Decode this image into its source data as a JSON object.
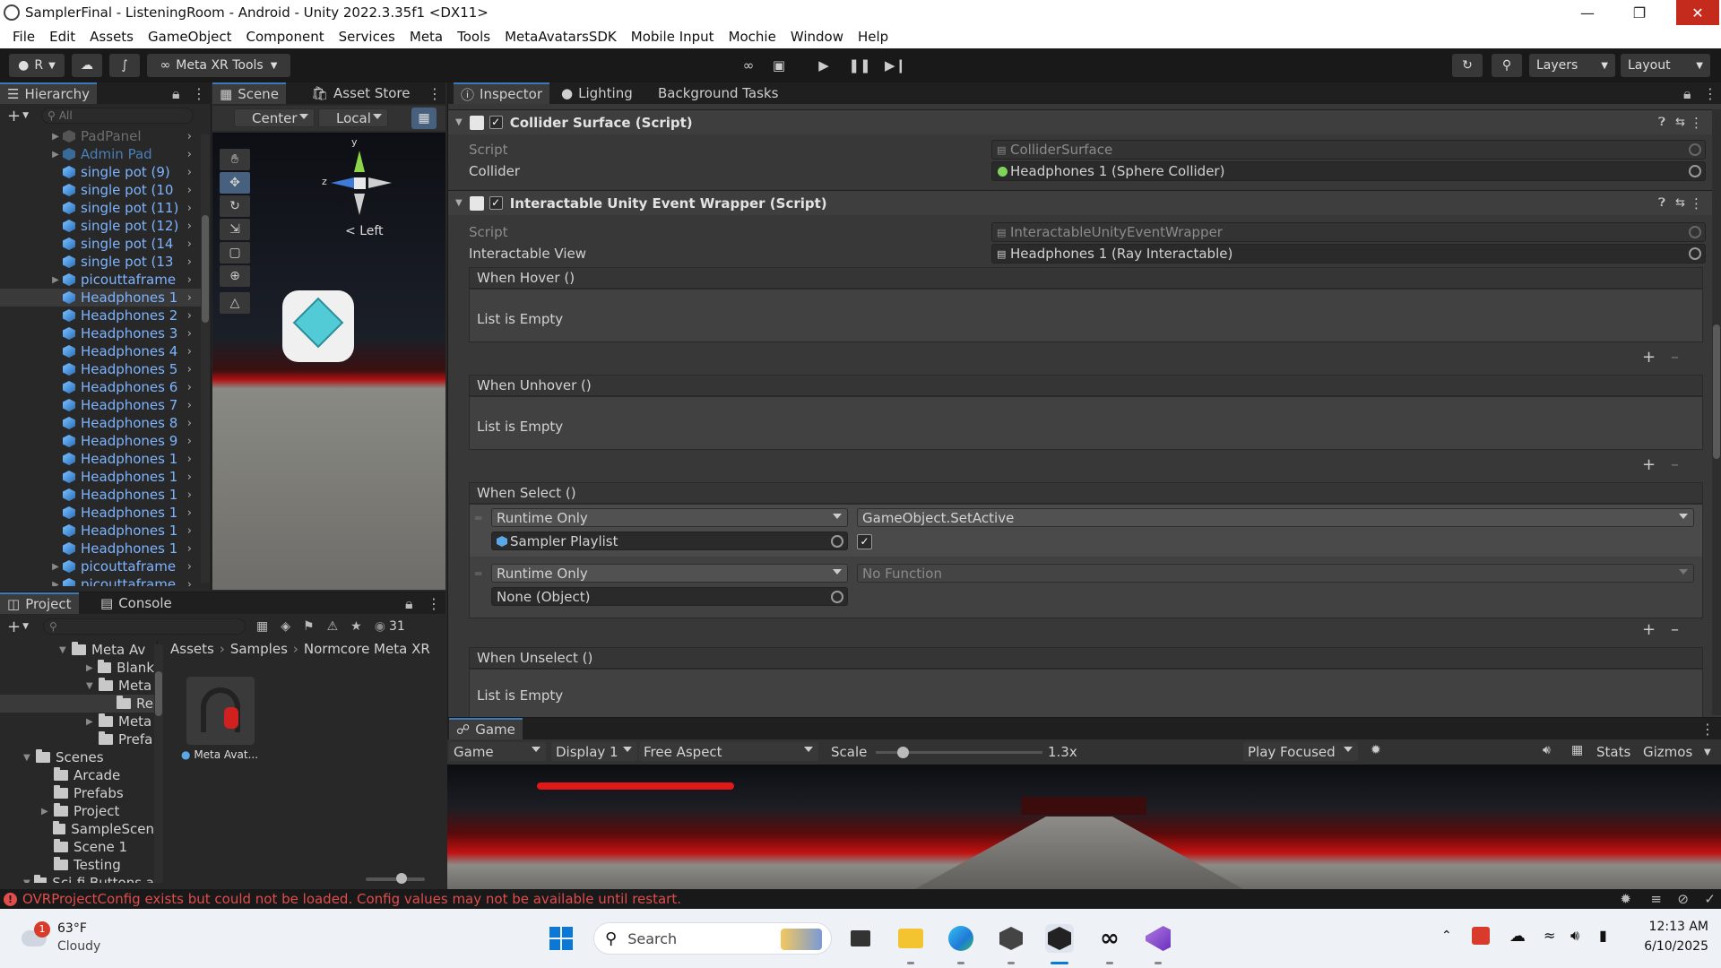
{
  "window": {
    "title": "SamplerFinal - ListeningRoom - Android - Unity 2022.3.35f1 <DX11>"
  },
  "menu": [
    "File",
    "Edit",
    "Assets",
    "GameObject",
    "Component",
    "Services",
    "Meta",
    "Tools",
    "MetaAvatarsSDK",
    "Mobile Input",
    "Mochie",
    "Window",
    "Help"
  ],
  "toolbar": {
    "account": "R",
    "meta_tools": "Meta XR Tools",
    "layers": "Layers",
    "layout": "Layout"
  },
  "hierarchy": {
    "tab": "Hierarchy",
    "search_placeholder": "All",
    "items": [
      "PadPanel",
      "Admin Pad",
      "single pot (9)",
      "single pot (10",
      "single pot (11)",
      "single pot (12)",
      "single pot (14",
      "single pot (13",
      "picouttaframe",
      "Headphones 1",
      "Headphones 2",
      "Headphones 3",
      "Headphones 4",
      "Headphones 5",
      "Headphones 6",
      "Headphones 7",
      "Headphones 8",
      "Headphones 9",
      "Headphones 1",
      "Headphones 1",
      "Headphones 1",
      "Headphones 1",
      "Headphones 1",
      "Headphones 1",
      "picouttaframe (1",
      "picouttaframe (2"
    ]
  },
  "scene": {
    "tabs": [
      "Scene",
      "Asset Store"
    ],
    "pivot": "Center",
    "space": "Local",
    "gizmo_label": "Left",
    "gizmo_y": "y",
    "gizmo_z": "z"
  },
  "inspector": {
    "tabs": [
      "Inspector",
      "Lighting",
      "Background Tasks"
    ],
    "components": [
      {
        "name": "Collider Surface (Script)",
        "props": [
          {
            "label": "Script",
            "value": "ColliderSurface"
          },
          {
            "label": "Collider",
            "value": "Headphones 1 (Sphere Collider)"
          }
        ]
      },
      {
        "name": "Interactable Unity Event Wrapper (Script)",
        "props": [
          {
            "label": "Script",
            "value": "InteractableUnityEventWrapper"
          },
          {
            "label": "Interactable View",
            "value": "Headphones 1 (Ray Interactable)"
          }
        ],
        "events": [
          {
            "title": "When Hover ()",
            "empty": "List is Empty"
          },
          {
            "title": "When Unhover ()",
            "empty": "List is Empty"
          },
          {
            "title": "When Select ()"
          },
          {
            "title": "When Unselect ()",
            "empty": "List is Empty"
          }
        ],
        "select_entries": [
          {
            "mode": "Runtime Only",
            "function": "GameObject.SetActive",
            "target": "Sampler Playlist"
          },
          {
            "mode": "Runtime Only",
            "function": "No Function",
            "target": "None (Object)"
          }
        ]
      }
    ]
  },
  "project": {
    "tabs": [
      "Project",
      "Console"
    ],
    "count": "31",
    "breadcrumb": [
      "Assets",
      "Samples",
      "Normcore Meta XR"
    ],
    "tree": [
      "Meta Av",
      "Blank",
      "Meta",
      "Re",
      "Meta",
      "Prefa",
      "Scenes",
      "Arcade",
      "Prefabs",
      "Project",
      "SampleScen",
      "Scene 1",
      "Testing",
      "Sci-fi Buttons a"
    ],
    "asset_name": "Meta Avat..."
  },
  "game": {
    "tab": "Game",
    "mode": "Game",
    "display": "Display 1",
    "aspect": "Free Aspect",
    "scale_label": "Scale",
    "scale_value": "1.3x",
    "play_mode": "Play Focused",
    "stats": "Stats",
    "gizmos": "Gizmos"
  },
  "status": {
    "message": "OVRProjectConfig exists but could not be loaded. Config values may not be available until restart."
  },
  "taskbar": {
    "weather_temp": "63°F",
    "weather_desc": "Cloudy",
    "weather_badge": "1",
    "search": "Search",
    "time": "12:13 AM",
    "date": "6/10/2025"
  }
}
